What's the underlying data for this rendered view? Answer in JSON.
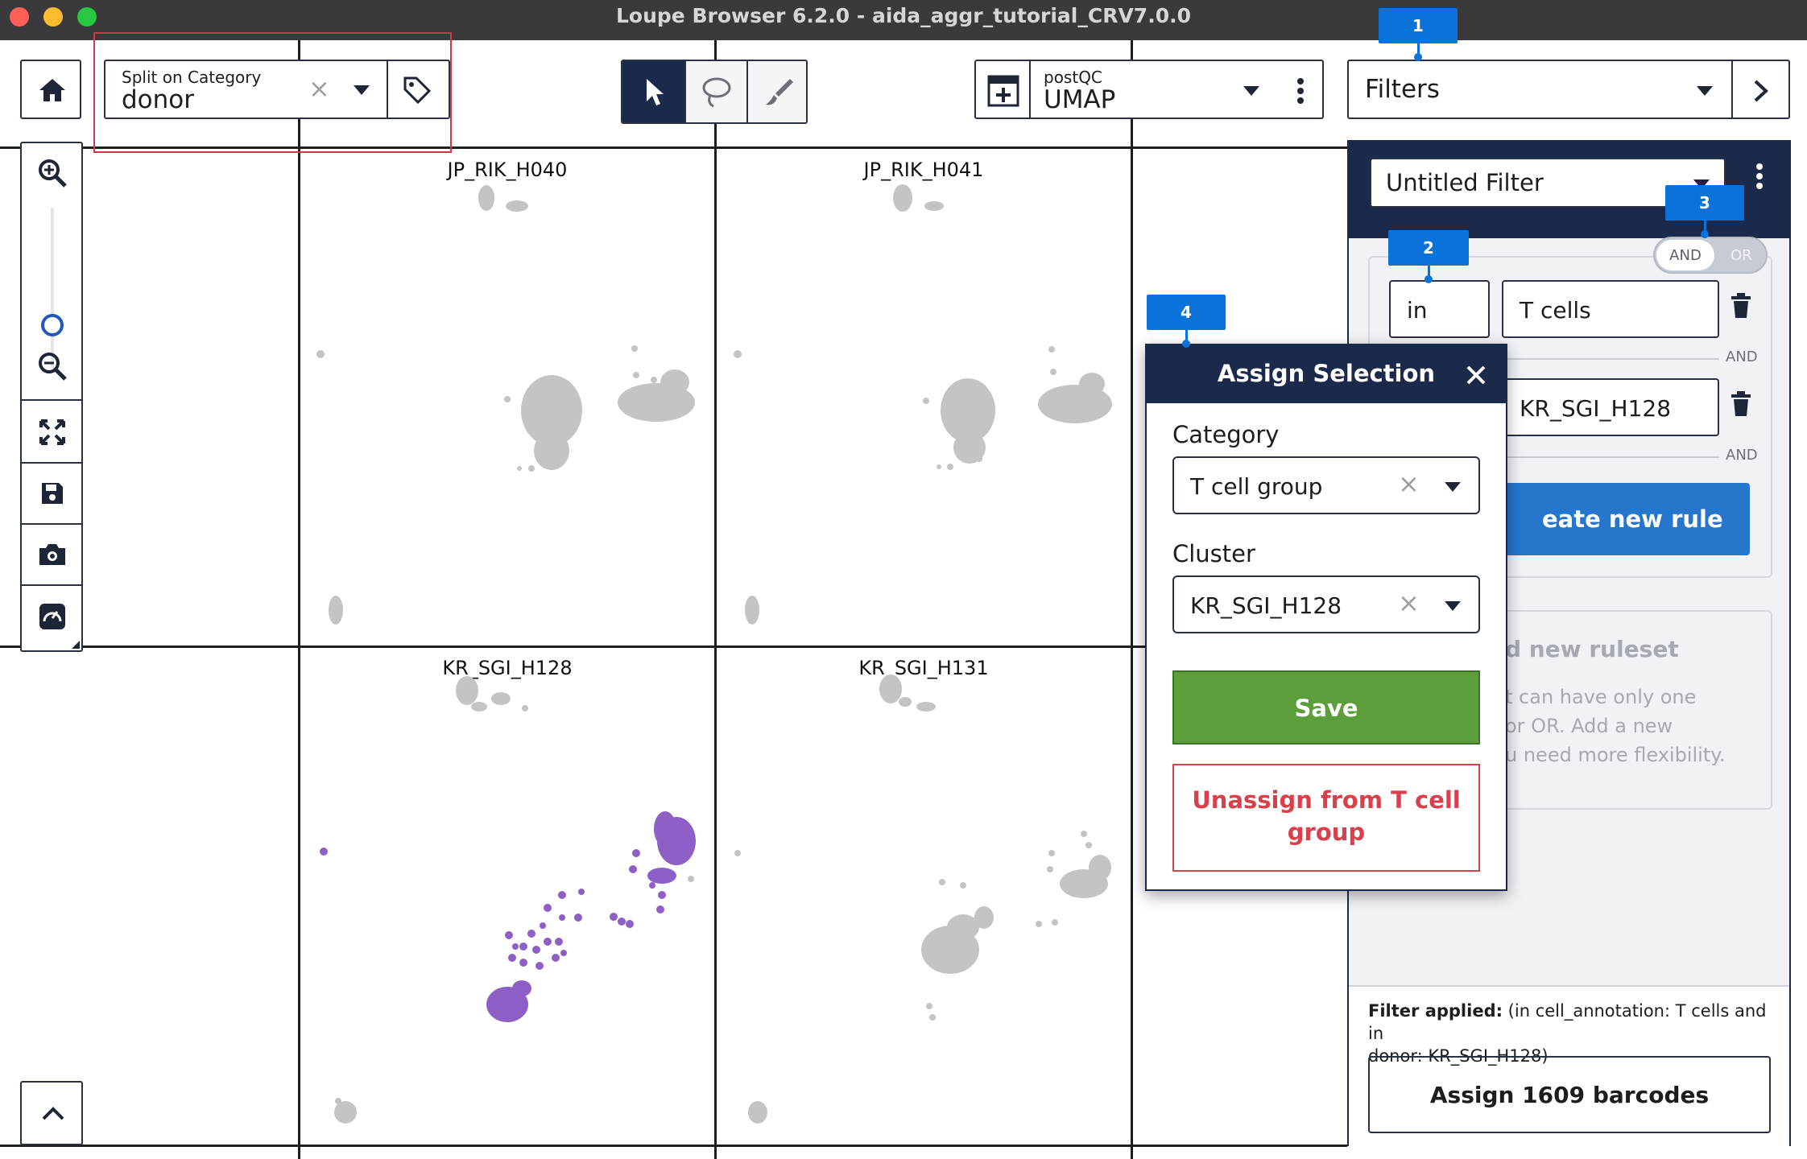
{
  "window": {
    "title": "Loupe Browser 6.2.0 - aida_aggr_tutorial_CRV7.0.0"
  },
  "split": {
    "label": "Split on Category",
    "value": "donor"
  },
  "projection": {
    "label": "postQC",
    "value": "UMAP"
  },
  "filters": {
    "dropdown_label": "Filters"
  },
  "panels": [
    {
      "title": "JP_RIK_H040"
    },
    {
      "title": "JP_RIK_H041"
    },
    {
      "title": "KR_SGI_H128"
    },
    {
      "title": "KR_SGI_H131"
    }
  ],
  "markers": [
    "1",
    "2",
    "3",
    "4"
  ],
  "filter_panel": {
    "filter_name": "Untitled Filter",
    "toggle": {
      "and": "AND",
      "or": "OR",
      "selected": "AND"
    },
    "rule1": {
      "operator": "in",
      "value": "T cells"
    },
    "connector": "AND",
    "rule2": {
      "value": "KR_SGI_H128"
    },
    "create_rule_label": "eate new rule",
    "ruleset": {
      "title": "d new ruleset",
      "lines": [
        "t can have only one",
        "or OR. Add a new",
        "u need more flexibility."
      ]
    },
    "filter_applied_label": "Filter applied:",
    "filter_applied_text": " (in cell_annotation: T cells and in",
    "filter_applied_text2": "donor: KR_SGI_H128)",
    "assign_button": "Assign 1609 barcodes"
  },
  "assign_popup": {
    "title": "Assign Selection",
    "category_label": "Category",
    "category_value": "T cell group",
    "cluster_label": "Cluster",
    "cluster_value": "KR_SGI_H128",
    "save": "Save",
    "unassign_line1": "Unassign from T cell",
    "unassign_line2": "group"
  },
  "colors": {
    "selected_cells": "#8e5fc6",
    "grey_cells": "#c4c4c4",
    "accent_blue": "#0b72d9",
    "save_green": "#5c9e3a",
    "unassign_red": "#d8404c"
  }
}
